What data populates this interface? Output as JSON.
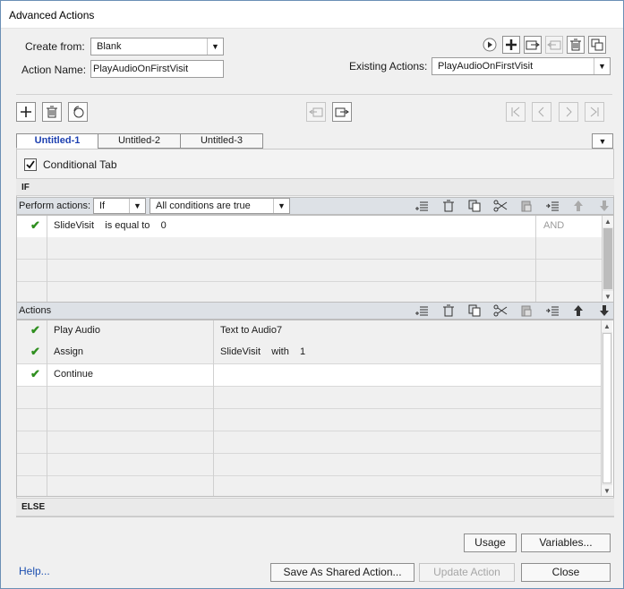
{
  "window": {
    "title": "Advanced Actions"
  },
  "form": {
    "create_from_label": "Create from:",
    "create_from_value": "Blank",
    "action_name_label": "Action Name:",
    "action_name_value": "PlayAudioOnFirstVisit",
    "existing_actions_label": "Existing Actions:",
    "existing_actions_value": "PlayAudioOnFirstVisit"
  },
  "tabs": [
    {
      "label": "Untitled-1",
      "active": true
    },
    {
      "label": "Untitled-2",
      "active": false
    },
    {
      "label": "Untitled-3",
      "active": false
    }
  ],
  "conditional": {
    "label": "Conditional Tab",
    "checked": true
  },
  "if_section": {
    "label": "IF",
    "perform_actions_label": "Perform actions:",
    "perform_value": "If",
    "conditions_value": "All conditions are true",
    "rows": [
      {
        "variable": "SlideVisit",
        "operator": "is equal to",
        "value": "0",
        "logic": "AND"
      }
    ]
  },
  "actions_section": {
    "label": "Actions",
    "rows": [
      {
        "action": "Play Audio",
        "target": "Text to Audio7"
      },
      {
        "action": "Assign",
        "target": "SlideVisit    with    1"
      },
      {
        "action": "Continue",
        "target": ""
      }
    ]
  },
  "else_section": {
    "label": "ELSE"
  },
  "buttons": {
    "usage": "Usage",
    "variables": "Variables...",
    "save_shared": "Save As Shared Action...",
    "update": "Update Action",
    "close": "Close",
    "help": "Help..."
  },
  "colors": {
    "accent": "#1c3fb0",
    "check": "#2f8f1f",
    "header_bar": "#dde1e6"
  }
}
